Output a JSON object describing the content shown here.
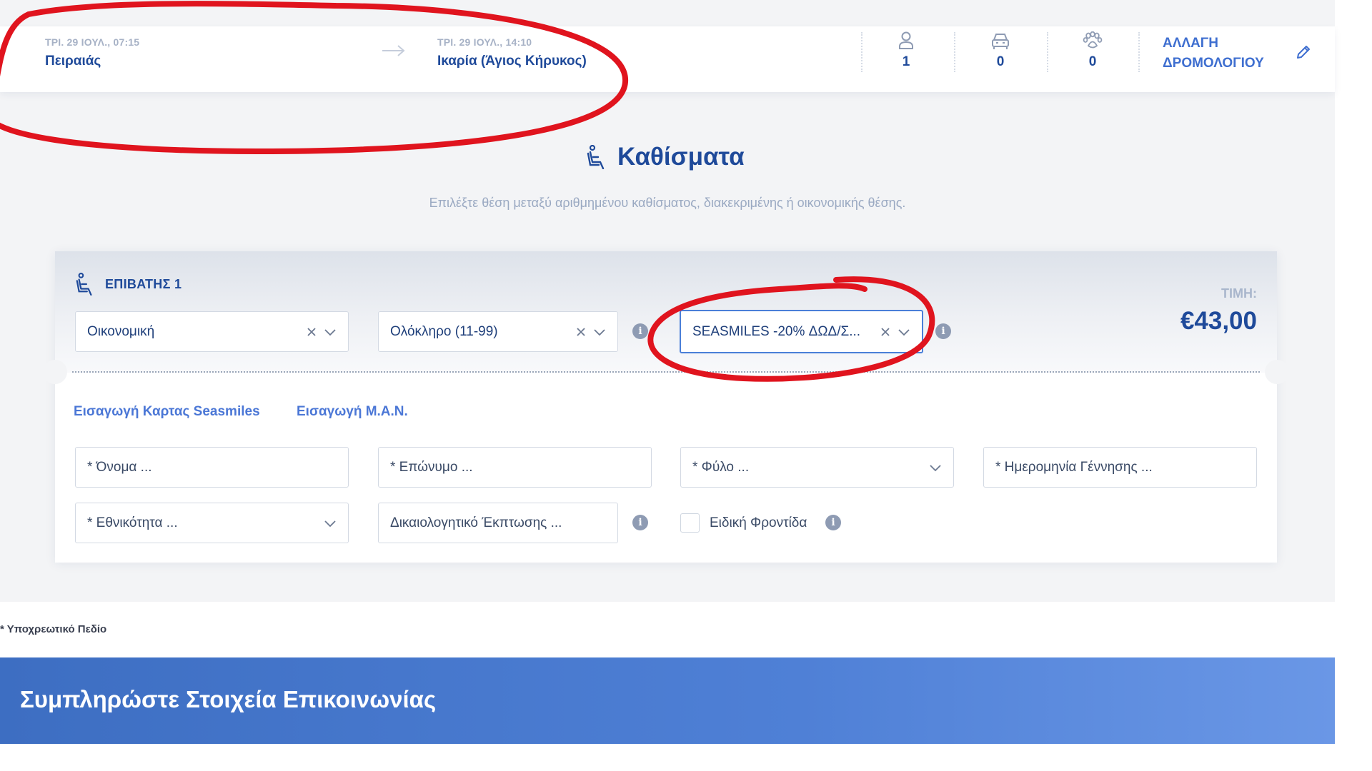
{
  "route": {
    "from": {
      "datetime": "ΤΡΙ. 29 ΙΟΥΛ., 07:15",
      "port": "Πειραιάς"
    },
    "to": {
      "datetime": "ΤΡΙ. 29 ΙΟΥΛ., 14:10",
      "port": "Ικαρία (Άγιος Κήρυκος)"
    },
    "counts": {
      "passengers": "1",
      "vehicles": "0",
      "pets": "0"
    },
    "change_line1": "ΑΛΛΑΓΗ",
    "change_line2": "ΔΡΟΜΟΛΟΓΙΟΥ"
  },
  "seats": {
    "title": "Καθίσματα",
    "subtitle": "Επιλέξτε θέση μεταξύ αριθμημένου καθίσματος, διακεκριμένης ή οικονομικής θέσης."
  },
  "passenger": {
    "label": "ΕΠΙΒΑΤΗΣ 1",
    "price_label": "ΤΙΜΗ:",
    "price": "€43,00",
    "seat_type": "Οικονομική",
    "ticket_type": "Ολόκληρο (11-99)",
    "discount": "SEASMILES -20% ΔΩΔ/Σ...",
    "link_seasmiles": "Εισαγωγή Καρτας Seasmiles",
    "link_man": "Εισαγωγή Μ.Α.Ν.",
    "first_name_placeholder": "* Όνομα ...",
    "last_name_placeholder": "* Επώνυμο ...",
    "gender_placeholder": "* Φύλο ...",
    "birthdate_placeholder": "* Ημερομηνία Γέννησης ...",
    "nationality_placeholder": "* Εθνικότητα ...",
    "discount_doc_placeholder": "Δικαιολογητικό Έκπτωσης ...",
    "special_care_label": "Ειδική Φροντίδα"
  },
  "footer": {
    "required_note": "* Υποχρεωτικό Πεδίο",
    "contact_banner": "Συμπληρώστε Στοιχεία Επικοινωνίας"
  },
  "colors": {
    "primary": "#1f4a9a",
    "link": "#4b77d6",
    "annotation": "#e0141e"
  }
}
